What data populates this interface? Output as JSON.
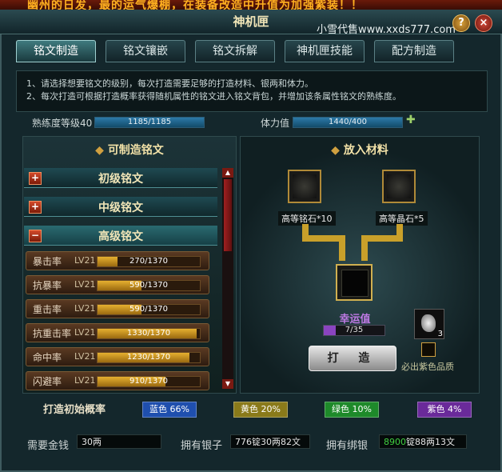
{
  "banner": "幽州的日发，最的运气爆棚，在装备改造中升值为加强紫装！！",
  "window": {
    "title": "神机匣",
    "watermark": "小雪代售www.xxds777.com"
  },
  "tabs": [
    {
      "label": "铭文制造",
      "active": true
    },
    {
      "label": "铭文镶嵌",
      "active": false
    },
    {
      "label": "铭文拆解",
      "active": false
    },
    {
      "label": "神机匣技能",
      "active": false
    },
    {
      "label": "配方制造",
      "active": false
    }
  ],
  "info": {
    "line1": "1、请选择想要铭文的级别，每次打造需要足够的打造材料、银两和体力。",
    "line2": "2、每次打造可根据打造概率获得随机属性的铭文进入铭文背包，并增加该条属性铭文的熟练度。"
  },
  "stats": {
    "proficiency_label": "熟练度等级40",
    "proficiency_value": "1185/1185",
    "proficiency_ratio": 1.0,
    "stamina_label": "体力值",
    "stamina_value": "1440/400",
    "stamina_ratio": 1.0
  },
  "left_panel": {
    "title": "可制造铭文",
    "categories": [
      {
        "label": "初级铭文",
        "sign": "+"
      },
      {
        "label": "中级铭文",
        "sign": "+"
      },
      {
        "label": "高级铭文",
        "sign": "−"
      }
    ],
    "items": [
      {
        "name": "暴击率",
        "level": "LV21",
        "progress": "270/1370",
        "ratio": 0.197
      },
      {
        "name": "抗暴率",
        "level": "LV21",
        "progress": "590/1370",
        "ratio": 0.431
      },
      {
        "name": "重击率",
        "level": "LV21",
        "progress": "590/1370",
        "ratio": 0.431
      },
      {
        "name": "抗重击率",
        "level": "LV21",
        "progress": "1330/1370",
        "ratio": 0.971
      },
      {
        "name": "命中率",
        "level": "LV21",
        "progress": "1230/1370",
        "ratio": 0.898
      },
      {
        "name": "闪避率",
        "level": "LV21",
        "progress": "910/1370",
        "ratio": 0.664
      }
    ]
  },
  "right_panel": {
    "title": "放入材料",
    "material1": "高等铭石*10",
    "material2": "高等晶石*5",
    "luck_label": "幸运值",
    "luck_value": "7/35",
    "luck_ratio": 0.2,
    "forge_button": "打 造",
    "stone_count": "3",
    "checkbox_label": "必出紫色品质"
  },
  "probability": {
    "label": "打造初始概率",
    "items": [
      {
        "label": "蓝色 66%",
        "color": "#1f4fae"
      },
      {
        "label": "黄色 20%",
        "color": "#8a7a1a"
      },
      {
        "label": "绿色 10%",
        "color": "#1e8a2a"
      },
      {
        "label": "紫色 4%",
        "color": "#6a2a9a"
      }
    ]
  },
  "bottom": {
    "gold_label": "需要金钱",
    "gold_value": "30两",
    "silver_label": "拥有银子",
    "silver_value": "776锭30两82文",
    "bound_label": "拥有绑银",
    "bound_value_green": "8900",
    "bound_value_rest": "锭88两13文"
  }
}
